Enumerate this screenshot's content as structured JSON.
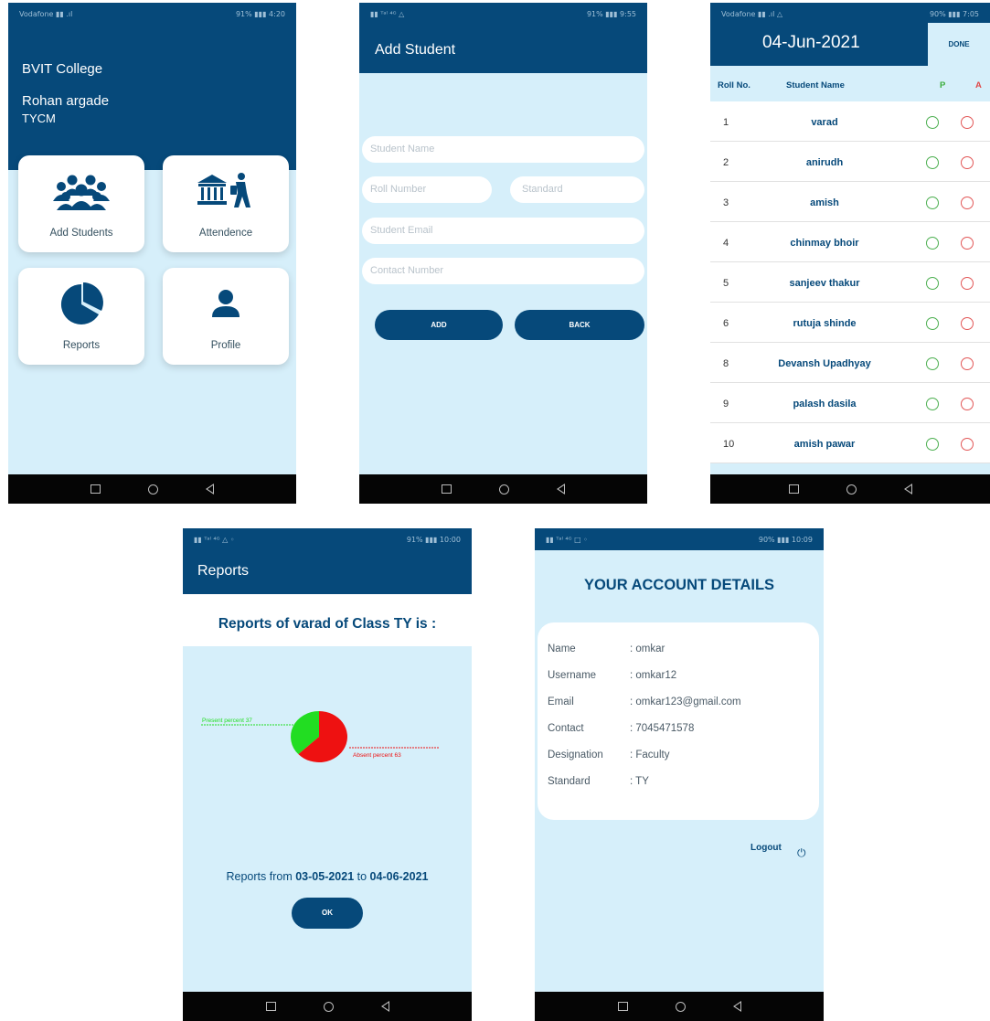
{
  "system": {
    "status_left_1": "Vodafone ▮▮ .ıl",
    "status_right_1": "91% ▮▮▮ 4:20",
    "status_left_2": "▮▮ ᵀᵃˡ ⁴ᴳ △",
    "status_right_2": "91% ▮▮▮ 9:55",
    "status_left_3": "Vodafone ▮▮ .ıl △",
    "status_right_3": "90% ▮▮▮ 7:05",
    "status_left_4": "▮▮ ᵀᵃˡ ⁴ᴳ △ ◦",
    "status_right_4": "91% ▮▮▮ 10:00",
    "status_left_5": "▮▮ ᵀᵃˡ ⁴ᴳ □ ◦",
    "status_right_5": "90% ▮▮▮ 10:09"
  },
  "home": {
    "college": "BVIT College",
    "user_name": "Rohan argade",
    "class": "TYCM",
    "tiles": [
      {
        "label": "Add Students",
        "icon": "group-icon"
      },
      {
        "label": "Attendence",
        "icon": "institution-icon"
      },
      {
        "label": "Reports",
        "icon": "pie-chart-icon"
      },
      {
        "label": "Profile",
        "icon": "person-icon"
      }
    ]
  },
  "add_student": {
    "title": "Add Student",
    "placeholders": {
      "name": "Student Name",
      "roll": "Roll Number",
      "standard": "Standard",
      "email": "Student Email",
      "contact": "Contact Number"
    },
    "add_label": "ADD",
    "back_label": "BACK"
  },
  "attendance": {
    "date": "04-Jun-2021",
    "done_label": "DONE",
    "col_roll": "Roll No.",
    "col_name": "Student Name",
    "col_p": "P",
    "col_a": "A",
    "rows": [
      {
        "roll": "1",
        "name": "varad"
      },
      {
        "roll": "2",
        "name": "anirudh"
      },
      {
        "roll": "3",
        "name": "amish"
      },
      {
        "roll": "4",
        "name": "chinmay bhoir"
      },
      {
        "roll": "5",
        "name": "sanjeev thakur"
      },
      {
        "roll": "6",
        "name": "rutuja shinde"
      },
      {
        "roll": "8",
        "name": "Devansh Upadhyay"
      },
      {
        "roll": "9",
        "name": "palash dasila"
      },
      {
        "roll": "10",
        "name": "amish pawar"
      }
    ]
  },
  "reports": {
    "title": "Reports",
    "heading": "Reports of varad of Class TY is :",
    "range_prefix": "Reports from ",
    "range_from": "03-05-2021",
    "range_mid": " to ",
    "range_to": "04-06-2021",
    "ok_label": "OK",
    "present_color": "#22dd22",
    "absent_color": "#ee1111"
  },
  "chart_data": {
    "type": "pie",
    "series": [
      {
        "name": "Present percent 37",
        "value": 37,
        "color": "#22dd22"
      },
      {
        "name": "Absent percent 63",
        "value": 63,
        "color": "#ee1111"
      }
    ]
  },
  "profile": {
    "title": "YOUR ACCOUNT DETAILS",
    "details": [
      {
        "key": "Name",
        "value": ": omkar"
      },
      {
        "key": "Username",
        "value": ": omkar12"
      },
      {
        "key": "Email",
        "value": ": omkar123@gmail.com"
      },
      {
        "key": "Contact",
        "value": ": 7045471578"
      },
      {
        "key": "Designation",
        "value": ": Faculty"
      },
      {
        "key": "Standard",
        "value": ": TY"
      }
    ],
    "logout_label": "Logout",
    "power_icon": "⏻"
  }
}
